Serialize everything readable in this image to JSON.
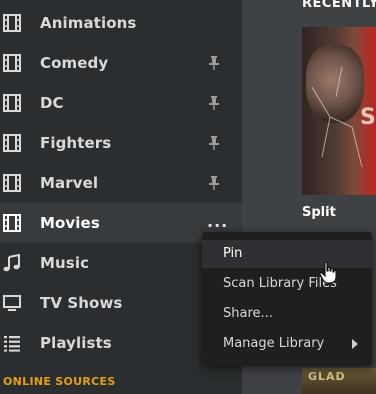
{
  "sidebar": {
    "items": [
      {
        "label": "Animations",
        "icon": "film-icon",
        "pinned": false
      },
      {
        "label": "Comedy",
        "icon": "film-icon",
        "pinned": true
      },
      {
        "label": "DC",
        "icon": "film-icon",
        "pinned": true
      },
      {
        "label": "Fighters",
        "icon": "film-icon",
        "pinned": true
      },
      {
        "label": "Marvel",
        "icon": "film-icon",
        "pinned": true
      },
      {
        "label": "Movies",
        "icon": "film-icon",
        "active": true,
        "more": "..."
      },
      {
        "label": "Music",
        "icon": "music-note-icon"
      },
      {
        "label": "TV Shows",
        "icon": "monitor-icon"
      },
      {
        "label": "Playlists",
        "icon": "list-icon"
      }
    ],
    "section_title": "ONLINE SOURCES"
  },
  "content": {
    "title": "RECENTLY",
    "poster_caption": "Split",
    "poster_text": "SP",
    "poster2_text": "GLAD"
  },
  "context_menu": {
    "items": [
      {
        "label": "Pin"
      },
      {
        "label": "Scan Library Files"
      },
      {
        "label": "Share..."
      },
      {
        "label": "Manage Library"
      }
    ]
  },
  "colors": {
    "sidebar_bg": "#2b2e30",
    "active_row_bg": "#383b3e",
    "accent": "#e5a00d",
    "menu_bg": "#1f1f1f"
  }
}
